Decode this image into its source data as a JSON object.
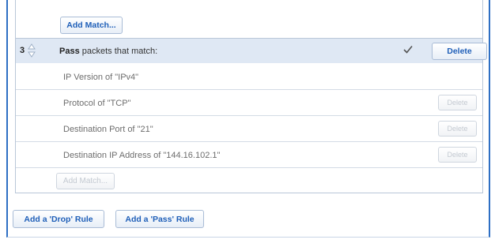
{
  "add_match_top": "Add Match...",
  "rule": {
    "number": "3",
    "action": "Pass",
    "title_rest": " packets that match:",
    "delete_label": "Delete",
    "checked": true
  },
  "conditions": [
    {
      "text": "IP Version of \"IPv4\"",
      "delete_label": null
    },
    {
      "text": "Protocol of \"TCP\"",
      "delete_label": "Delete"
    },
    {
      "text": "Destination Port of \"21\"",
      "delete_label": "Delete"
    },
    {
      "text": "Destination IP Address of \"144.16.102.1\"",
      "delete_label": "Delete"
    }
  ],
  "add_match_bottom": "Add Match...",
  "add_drop_rule": "Add a 'Drop' Rule",
  "add_pass_rule": "Add a 'Pass' Rule",
  "colors": {
    "accent": "#2e6fc4",
    "selected_row": "#dfe8f4"
  }
}
